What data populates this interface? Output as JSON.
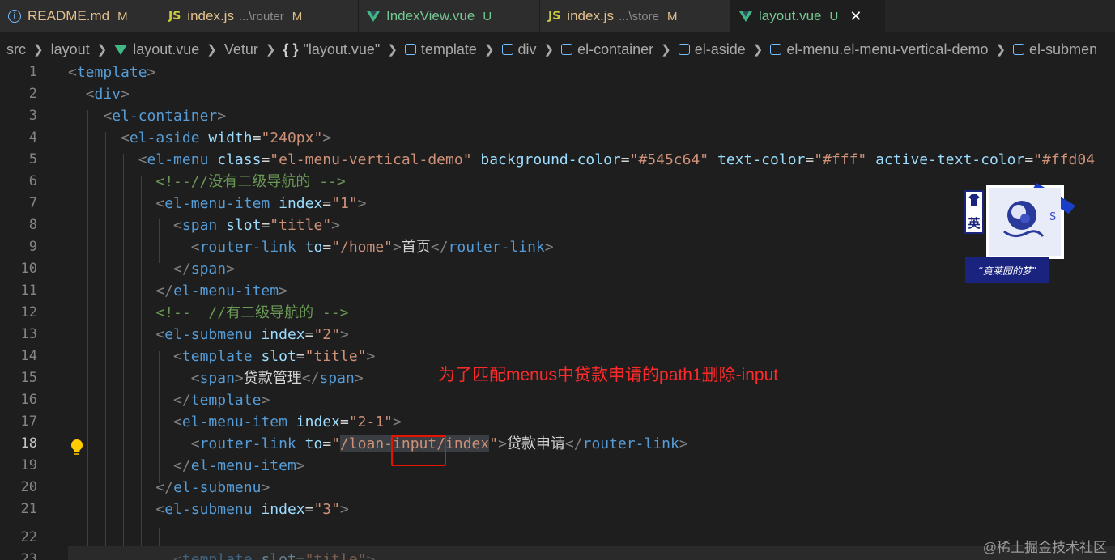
{
  "tabs": [
    {
      "icon": "info-icon",
      "name": "README.md",
      "desc": "",
      "badge": "M",
      "state": "modified"
    },
    {
      "icon": "js-icon",
      "name": "index.js",
      "desc": "...\\router",
      "badge": "M",
      "state": "modified"
    },
    {
      "icon": "vue-icon",
      "name": "IndexView.vue",
      "desc": "",
      "badge": "U",
      "state": "untracked"
    },
    {
      "icon": "js-icon",
      "name": "index.js",
      "desc": "...\\store",
      "badge": "M",
      "state": "modified"
    },
    {
      "icon": "vue-icon",
      "name": "layout.vue",
      "desc": "",
      "badge": "U",
      "state": "untracked",
      "active": true
    }
  ],
  "tab_icons": {
    "js": "JS",
    "info": "i",
    "close": "✕"
  },
  "breadcrumb": [
    "src",
    "layout",
    "layout.vue",
    "Vetur",
    "\"layout.vue\"",
    "template",
    "div",
    "el-container",
    "el-aside",
    "el-menu.el-menu-vertical-demo",
    "el-submen"
  ],
  "breadcrumb_braces": "{ }",
  "line_numbers": [
    "1",
    "2",
    "3",
    "4",
    "5",
    "6",
    "7",
    "8",
    "9",
    "10",
    "11",
    "12",
    "13",
    "14",
    "15",
    "16",
    "17",
    "18",
    "19",
    "20",
    "21",
    "22",
    "23"
  ],
  "current_line": "18",
  "annotation": "为了匹配menus中贷款申请的path1删除-input",
  "watermark": "@稀土掘金技术社区",
  "sticker_text": {
    "char": "英",
    "caption": "“竟莱园的梦”",
    "letter": "S"
  },
  "colors": {
    "tag": "#569cd6",
    "attr": "#9cdcfe",
    "string": "#ce9178",
    "comment": "#6a9955",
    "annotation": "#ff2a2a",
    "modified": "#e2c08d",
    "untracked": "#73c991"
  }
}
